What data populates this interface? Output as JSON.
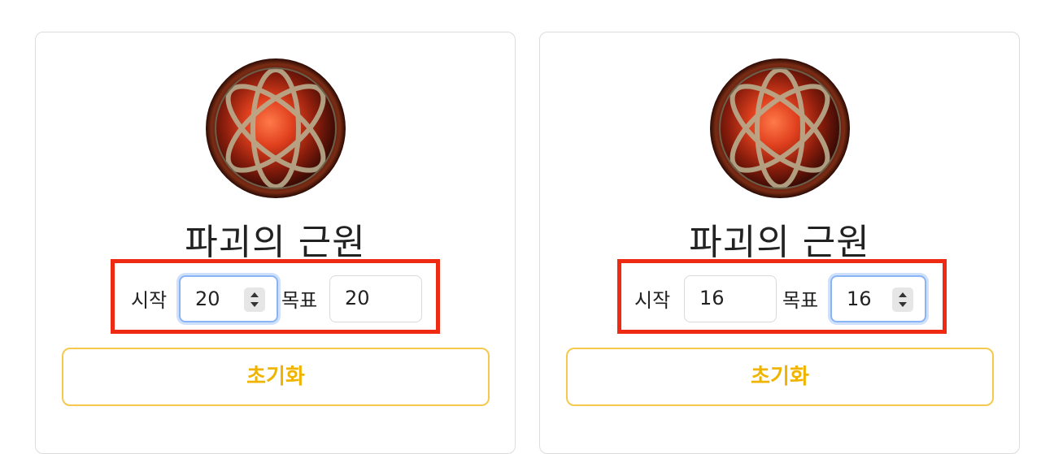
{
  "cards": [
    {
      "title": "파괴의 근원",
      "start_label": "시작",
      "start_value": "20",
      "target_label": "목표",
      "target_value": "20",
      "reset_label": "초기화",
      "focused_field": "start"
    },
    {
      "title": "파괴의 근원",
      "start_label": "시작",
      "start_value": "16",
      "target_label": "목표",
      "target_value": "16",
      "reset_label": "초기화",
      "focused_field": "target"
    }
  ],
  "colors": {
    "highlight": "#ee2a12",
    "button_accent": "#f0b400",
    "focus_ring": "#89b5f7"
  },
  "icons": {
    "orb": "destruction-orb-icon",
    "spinner": "stepper-arrows-icon"
  }
}
